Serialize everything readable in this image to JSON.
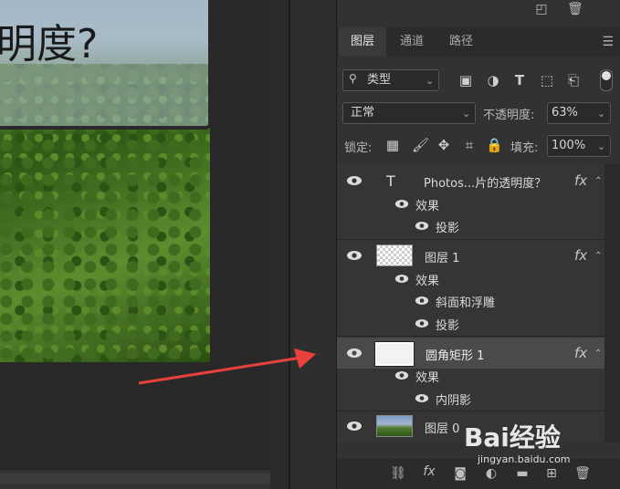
{
  "canvas": {
    "title_text": "明度?"
  },
  "panel": {
    "tabs": [
      {
        "label": "图层",
        "active": true
      },
      {
        "label": "通道",
        "active": false
      },
      {
        "label": "路径",
        "active": false
      }
    ],
    "filter": {
      "search_value": "类型"
    },
    "blend_mode": "正常",
    "opacity_label": "不透明度:",
    "opacity_value": "63%",
    "lock_label": "锁定:",
    "fill_label": "填充:",
    "fill_value": "100%",
    "fx_label": "fx",
    "layers": [
      {
        "name": "Photos...片的透明度？",
        "type": "text",
        "effects_label": "效果",
        "effects": [
          "投影"
        ]
      },
      {
        "name": "图层 1",
        "type": "raster",
        "effects_label": "效果",
        "effects": [
          "斜面和浮雕",
          "投影"
        ]
      },
      {
        "name": "圆角矩形 1",
        "type": "shape",
        "selected": true,
        "effects_label": "效果",
        "effects": [
          "内阴影"
        ]
      },
      {
        "name": "图层 0",
        "type": "photo"
      }
    ],
    "text_layer_glyph": "T"
  },
  "watermark": {
    "brand": "Bai经验",
    "url": "jingyan.baidu.com"
  },
  "colors": {
    "panel_bg": "#323232",
    "arrow": "#e8413b",
    "selected_row": "#4a4a4a"
  }
}
